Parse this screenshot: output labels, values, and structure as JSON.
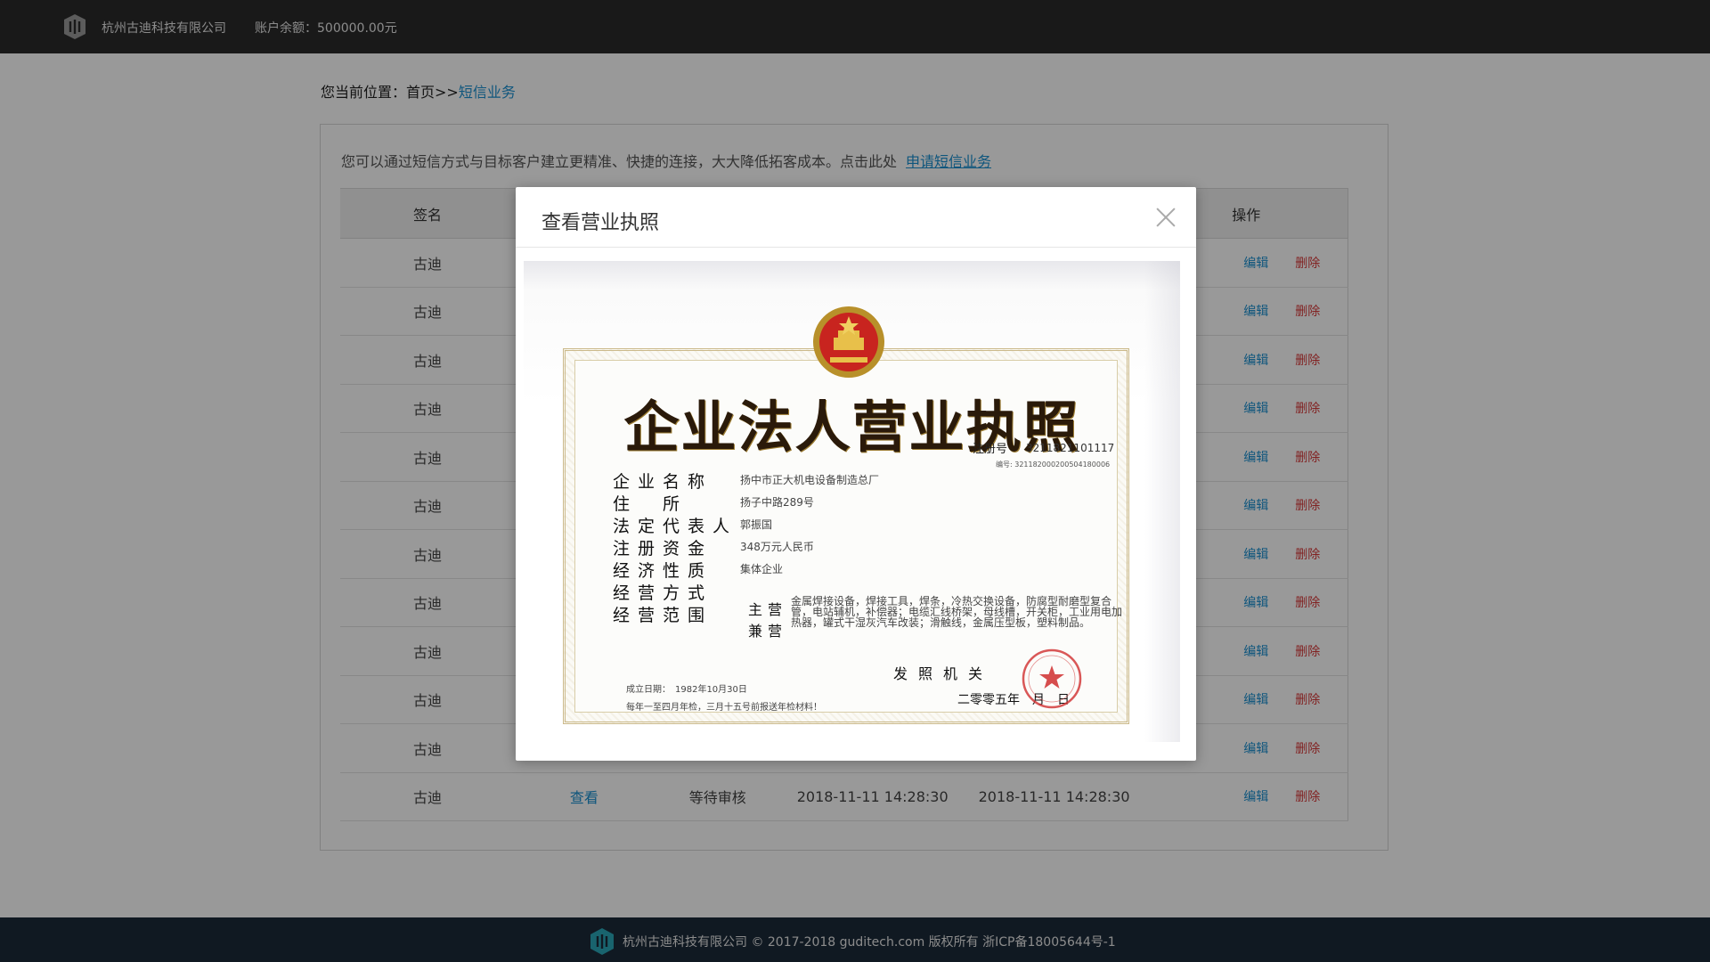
{
  "header": {
    "company": "杭州古迪科技有限公司",
    "balance": "账户余额：500000.00元"
  },
  "breadcrumb": {
    "prefix": "您当前位置：首页>>",
    "current": "短信业务"
  },
  "notice": {
    "text": "您可以通过短信方式与目标客户建立更精准、快捷的连接，大大降低拓客成本。点击此处",
    "link": "申请短信业务"
  },
  "table": {
    "headers": [
      "签名",
      "",
      "",
      "",
      "",
      "操作"
    ],
    "rows": [
      {
        "sign": "古迪",
        "edit": "编辑",
        "delete": "删除"
      },
      {
        "sign": "古迪",
        "edit": "编辑",
        "delete": "删除"
      },
      {
        "sign": "古迪",
        "edit": "编辑",
        "delete": "删除"
      },
      {
        "sign": "古迪",
        "edit": "编辑",
        "delete": "删除"
      },
      {
        "sign": "古迪",
        "edit": "编辑",
        "delete": "删除"
      },
      {
        "sign": "古迪",
        "edit": "编辑",
        "delete": "删除"
      },
      {
        "sign": "古迪",
        "edit": "编辑",
        "delete": "删除"
      },
      {
        "sign": "古迪",
        "edit": "编辑",
        "delete": "删除"
      },
      {
        "sign": "古迪",
        "edit": "编辑",
        "delete": "删除"
      },
      {
        "sign": "古迪",
        "edit": "编辑",
        "delete": "删除"
      },
      {
        "sign": "古迪",
        "edit": "编辑",
        "delete": "删除"
      },
      {
        "sign": "古迪",
        "view": "查看",
        "status": "等待审核",
        "created": "2018-11-11 14:28:30",
        "updated": "2018-11-11 14:28:30",
        "edit": "编辑",
        "delete": "删除"
      }
    ]
  },
  "footer": {
    "text": "杭州古迪科技有限公司 © 2017-2018 guditech.com 版权所有 浙ICP备18005644号-1"
  },
  "modal": {
    "title": "查看营业执照",
    "license": {
      "title": "企业法人营业执照",
      "reg_label": "注册号",
      "reg_no": "3211821101117",
      "serial": "编号: 321182000200504180006",
      "fields": [
        {
          "label": "企业名称",
          "value": "扬中市正大机电设备制造总厂"
        },
        {
          "label": "住　所",
          "value": "扬子中路289号"
        },
        {
          "label": "法定代表人",
          "value": "郭振国"
        },
        {
          "label": "注册资金",
          "value": "348万元人民币"
        },
        {
          "label": "经济性质",
          "value": "集体企业"
        },
        {
          "label": "经营方式",
          "value": ""
        },
        {
          "label": "经营范围",
          "value": ""
        }
      ],
      "main_label": "主营",
      "side_label": "兼营",
      "business": "金属焊接设备，焊接工具，焊条，冷热交换设备，防腐型耐磨型复合管，电站辅机，补偿器；电缆汇线桥架，母线槽，开关柜，工业用电加热器，罐式干湿灰汽车改装；滑触线，金属压型板，塑料制品。",
      "founded": "成立日期：　1982年10月30日",
      "annual": "每年一至四月年检，三月十五号前报送年检材料！",
      "issuer": "发照机关",
      "date": "二零零五年　月　日"
    }
  }
}
